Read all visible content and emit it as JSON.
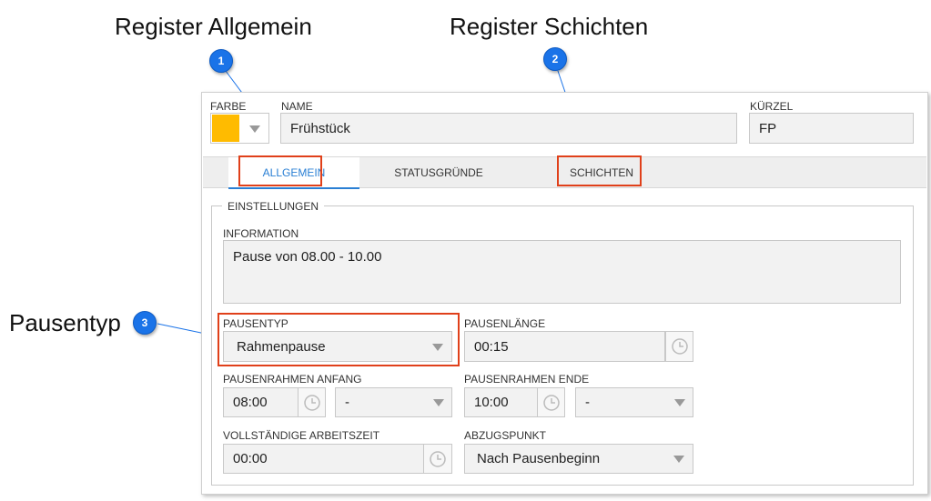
{
  "callouts": {
    "one": {
      "number": "1",
      "title": "Register Allgemein"
    },
    "two": {
      "number": "2",
      "title": "Register Schichten"
    },
    "three": {
      "number": "3",
      "title": "Pausentyp"
    }
  },
  "header": {
    "color_label": "FARBE",
    "color_value": "#ffbb00",
    "name_label": "NAME",
    "name_value": "Frühstück",
    "short_label": "KÜRZEL",
    "short_value": "FP"
  },
  "tabs": [
    {
      "label": "ALLGEMEIN",
      "active": true
    },
    {
      "label": "STATUSGRÜNDE",
      "active": false
    },
    {
      "label": "SCHICHTEN",
      "active": false
    }
  ],
  "settings": {
    "legend": "EINSTELLUNGEN",
    "information_label": "INFORMATION",
    "information_value": "Pause von 08.00 - 10.00",
    "break_type_label": "PAUSENTYP",
    "break_type_value": "Rahmenpause",
    "break_length_label": "PAUSENLÄNGE",
    "break_length_value": "00:15",
    "frame_start_label": "PAUSENRAHMEN ANFANG",
    "frame_start_time": "08:00",
    "frame_start_select": "-",
    "frame_end_label": "PAUSENRAHMEN ENDE",
    "frame_end_time": "10:00",
    "frame_end_select": "-",
    "full_worktime_label": "VOLLSTÄNDIGE ARBEITSZEIT",
    "full_worktime_value": "00:00",
    "deduction_label": "ABZUGSPUNKT",
    "deduction_value": "Nach Pausenbeginn"
  },
  "colors": {
    "accent": "#1a73e8",
    "highlight": "#e0401a",
    "active_tab_text": "#2a7fd4"
  }
}
